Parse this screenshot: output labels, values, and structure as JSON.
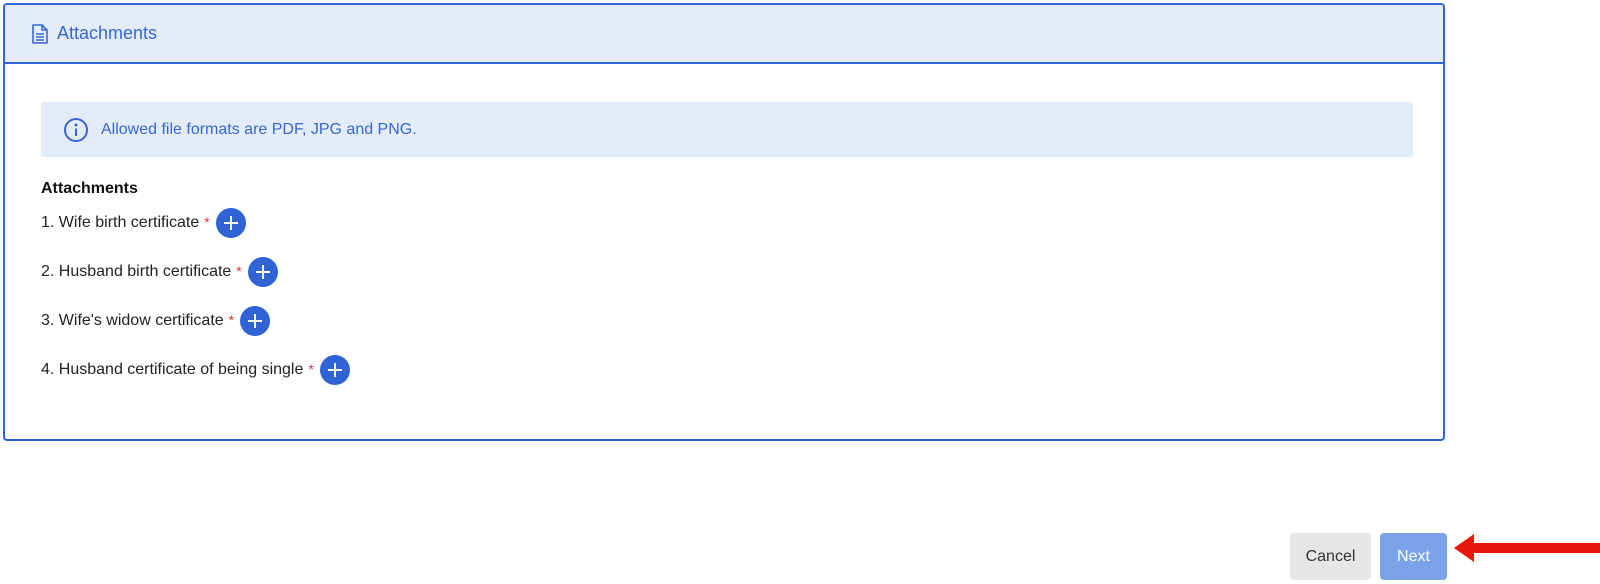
{
  "card": {
    "title": "Attachments",
    "title_icon": "document-icon",
    "info": {
      "icon": "info-circle-icon",
      "text": "Allowed file formats are PDF, JPG and PNG."
    },
    "section_title": "Attachments",
    "items": [
      {
        "label": "1. Wife birth certificate",
        "required": "*"
      },
      {
        "label": "2. Husband birth certificate",
        "required": "*"
      },
      {
        "label": "3. Wife's widow certificate",
        "required": "*"
      },
      {
        "label": "4. Husband certificate of being single",
        "required": "*"
      }
    ]
  },
  "footer": {
    "cancel_label": "Cancel",
    "next_label": "Next"
  },
  "annotation": {
    "arrow_icon": "red-arrow-left-icon",
    "arrow_color": "#e8160c"
  },
  "colors": {
    "primary": "#2f63d6",
    "header_bg": "#e2edf9",
    "next_disabled": "#7aa3ea",
    "required": "#e0302b"
  }
}
